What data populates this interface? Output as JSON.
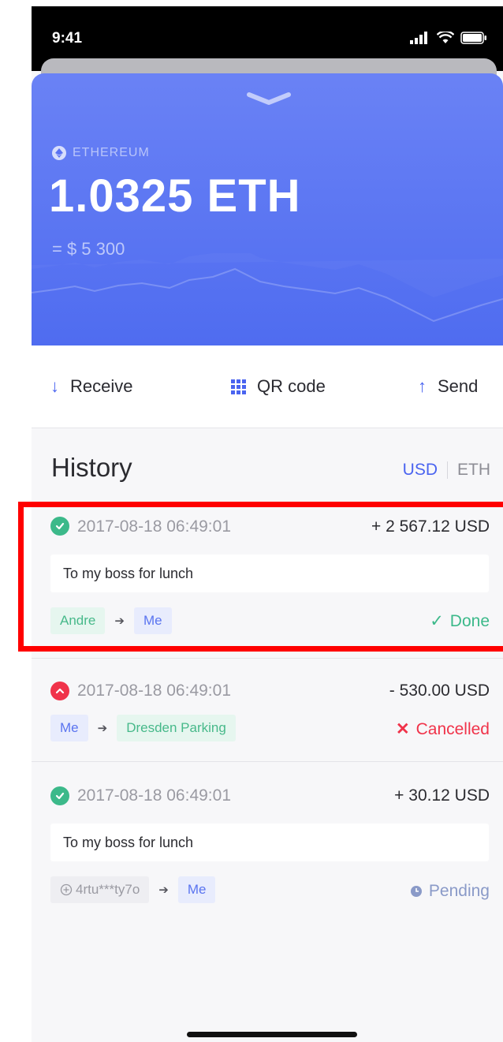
{
  "status_bar": {
    "time": "9:41"
  },
  "wallet": {
    "coin_label": "ETHEREUM",
    "balance": "1.0325 ETH",
    "fiat_value": "= $ 5 300"
  },
  "actions": {
    "receive": "Receive",
    "qr_code": "QR code",
    "send": "Send"
  },
  "history": {
    "title": "History",
    "currency_usd": "USD",
    "currency_eth": "ETH",
    "transactions": [
      {
        "status_icon": "check-circle-icon",
        "date": "2017-08-18 06:49:01",
        "amount": "+ 2 567.12 USD",
        "note": "To my boss for lunch",
        "from": "Andre",
        "to": "Me",
        "status": "Done",
        "status_color": "#3cb98a"
      },
      {
        "status_icon": "error-circle-icon",
        "date": "2017-08-18 06:49:01",
        "amount": "- 530.00 USD",
        "from": "Me",
        "to": "Dresden Parking",
        "status": "Cancelled",
        "status_color": "#f0334a"
      },
      {
        "status_icon": "check-circle-icon",
        "date": "2017-08-18 06:49:01",
        "amount": "+ 30.12 USD",
        "note": "To my boss for lunch",
        "from": "4rtu***ty7o",
        "to": "Me",
        "status": "Pending",
        "status_color": "#8a9ac8"
      }
    ]
  },
  "colors": {
    "accent": "#4a64f0",
    "card_top": "#6a82f5",
    "card_bottom": "#4f6cf0",
    "done": "#3cb98a",
    "cancelled": "#f0334a",
    "pending": "#8a9ac8",
    "highlight": "#ff0000"
  }
}
